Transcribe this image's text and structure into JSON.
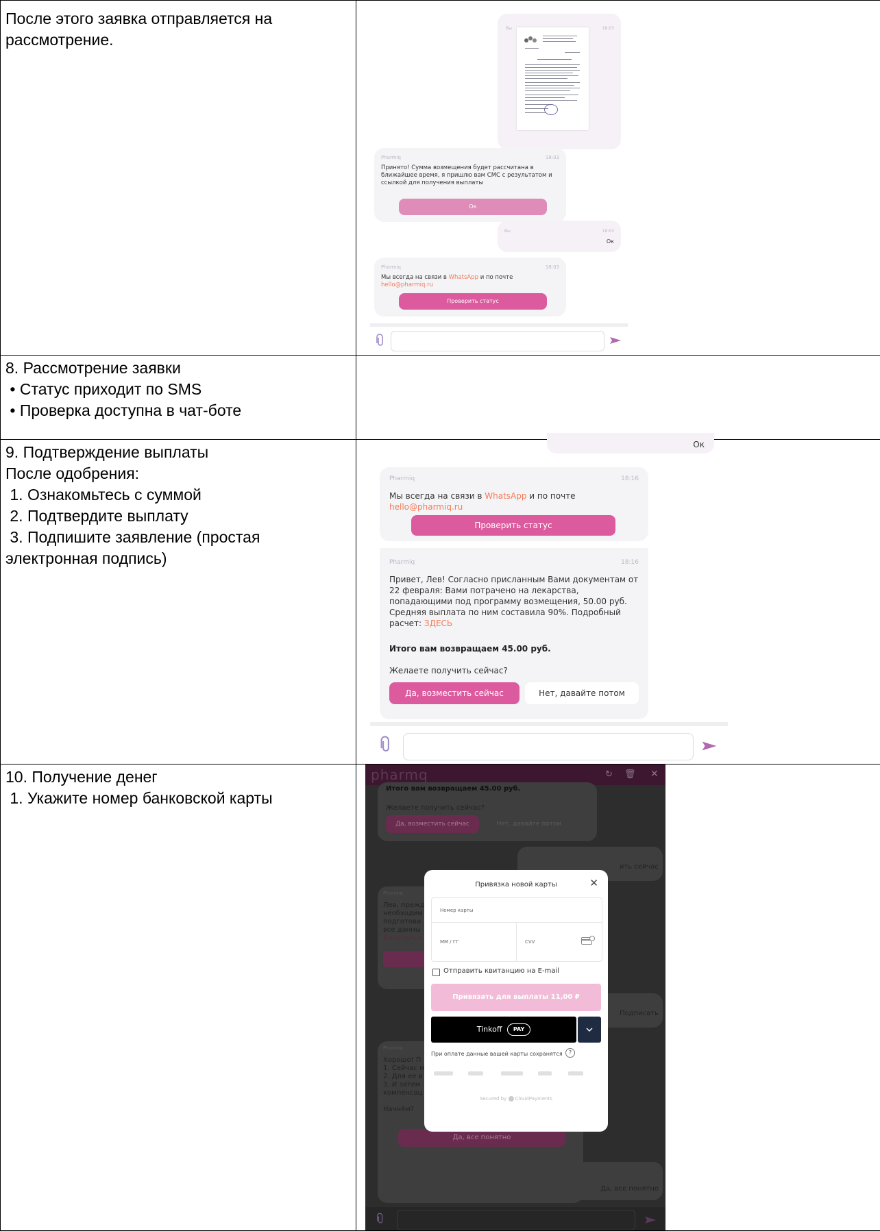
{
  "rows": [
    {
      "lines": [
        "После этого заявка отправляется на",
        "рассмотрение."
      ]
    },
    {
      "lines": [
        "8. Рассмотрение заявки",
        " • Статус приходит по SMS",
        " • Проверка доступна в чат-боте"
      ]
    },
    {
      "lines": [
        "9. Подтверждение выплаты",
        "После одобрения:",
        " 1. Ознакомьтесь с суммой",
        " 2. Подтвердите выплату",
        " 3. Подпишите заявление (простая",
        "электронная подпись)"
      ]
    },
    {
      "lines": [
        "10. Получение денег",
        " 1. Укажите номер банковской карты"
      ]
    }
  ],
  "shot1": {
    "user_label": "Вы",
    "time": "18:03",
    "bot_label": "Pharmiq",
    "bot_msg1": "Принято! Сумма возмещения будет рассчитана в ближайшее время, я пришлю вам СМС с результатом и ссылкой для получения выплаты",
    "ok_button": "Ок",
    "user_reply": "Ок",
    "bot_msg2_pre": "Мы всегда на связи в ",
    "whatsapp": "WhatsApp",
    "bot_msg2_mid": " и по почте ",
    "email": "hello@pharmiq.ru",
    "status_button": "Проверить статус"
  },
  "shot2": {
    "ok_text": "Ок",
    "bot_label": "Pharmiq",
    "time": "18:16",
    "msg1_pre": "Мы всегда на связи в ",
    "whatsapp": "WhatsApp",
    "msg1_mid": " и по почте",
    "email": "hello@pharmiq.ru",
    "status_button": "Проверить статус",
    "msg2": "Привет, Лев! Согласно присланным Вами документам от 22 февраля: Вами потрачено на лекарства, попадающими под программу возмещения, 50.00 руб. Средняя выплата по ним составила 90%. Подробный расчет: ",
    "here_link": "ЗДЕСЬ",
    "total": "Итого вам возвращаем 45.00 руб.",
    "question": "Желаете получить сейчас?",
    "yes_button": "Да, возместить сейчас",
    "no_button": "Нет, давайте потом"
  },
  "shot3": {
    "logo": "pharmq",
    "bg_total": "Итого вам возвращаем 45.00 руб.",
    "bg_question": "Желаете получить сейчас?",
    "bg_yes": "Да, возместить сейчас",
    "bg_no": "Нет, давайте потом",
    "bg_user_reply1": "ить сейчас",
    "bg_bot_label": "Pharmiq",
    "bg_msg_lines": [
      "Лев, прежд",
      "необходим",
      "подготови",
      "все данны",
      "Касательн"
    ],
    "bg_sign": "Подписать",
    "bg_msg2_lines": [
      "Хорошо! П",
      "1. Сейчас м",
      "2. Для ее в",
      "3. И затем",
      "компенсац"
    ],
    "bg_start": "Начнём?",
    "bg_ok_button": "Да, все понятно",
    "bg_user_reply2": "Да, все понятно",
    "modal_title": "Привязка новой карты",
    "card_number_placeholder": "Номер карты",
    "expiry_placeholder": "ММ / ГГ",
    "cvv_placeholder": "CVV",
    "email_checkbox": "Отправить квитанцию на E-mail",
    "bind_button": "Привязать для выплаты 11,00 ₽",
    "tinkoff_label": "Tinkoff",
    "pay_label": "PAY",
    "save_note": "При оплате данные вашей карты сохранятся",
    "secured": "Secured by",
    "cloud": "CloudPayments"
  },
  "colors": {
    "pink": "#dc5a9e",
    "light_pink": "#f2bcd8",
    "link": "#f27b5a",
    "dark_bg": "#2d2d2d",
    "header_purple": "#3d1730"
  }
}
